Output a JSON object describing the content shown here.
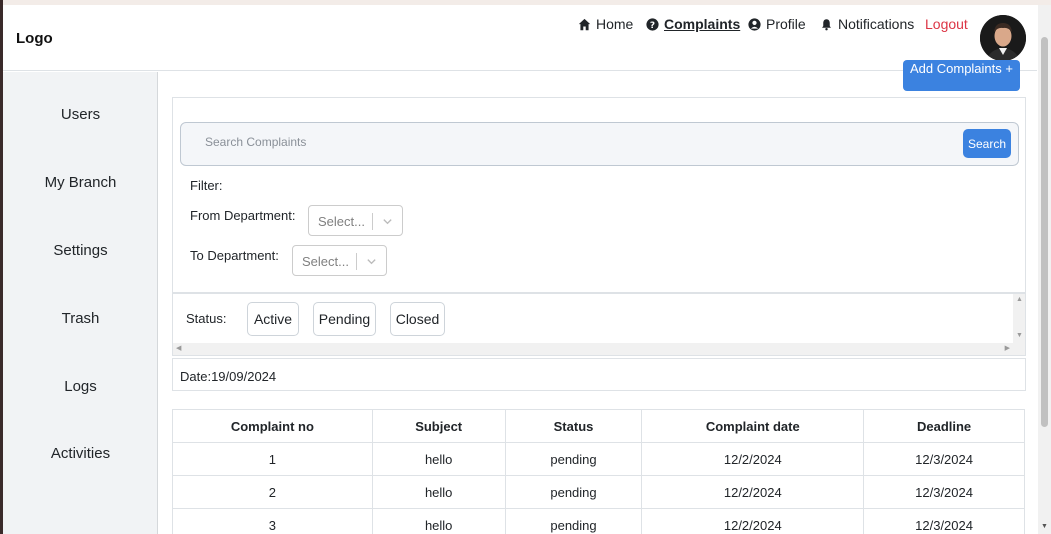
{
  "header": {
    "logo": "Logo",
    "nav": [
      {
        "label": "Home",
        "icon": "home-icon"
      },
      {
        "label": "Complaints",
        "icon": "question-circle-icon"
      },
      {
        "label": "Profile",
        "icon": "user-circle-icon"
      },
      {
        "label": "Notifications",
        "icon": "bell-icon"
      }
    ],
    "logout": "Logout"
  },
  "sidebar": {
    "items": [
      {
        "label": "Users"
      },
      {
        "label": "My Branch"
      },
      {
        "label": "Settings"
      },
      {
        "label": "Trash"
      },
      {
        "label": "Logs"
      },
      {
        "label": "Activities"
      }
    ]
  },
  "main": {
    "add_button": "Add Complaints +",
    "search": {
      "placeholder": "Search Complaints",
      "button": "Search"
    },
    "filter_label": "Filter:",
    "from_department": {
      "label": "From Department:",
      "placeholder": "Select..."
    },
    "to_department": {
      "label": "To Department:",
      "placeholder": "Select..."
    },
    "status": {
      "label": "Status:",
      "options": [
        "Active",
        "Pending",
        "Closed"
      ]
    },
    "date": "Date:19/09/2024",
    "table": {
      "headers": [
        "Complaint no",
        "Subject",
        "Status",
        "Complaint date",
        "Deadline"
      ],
      "rows": [
        [
          "1",
          "hello",
          "pending",
          "12/2/2024",
          "12/3/2024"
        ],
        [
          "2",
          "hello",
          "pending",
          "12/2/2024",
          "12/3/2024"
        ],
        [
          "3",
          "hello",
          "pending",
          "12/2/2024",
          "12/3/2024"
        ]
      ]
    }
  },
  "colors": {
    "accent": "#3b82e0",
    "logout": "#dc3545",
    "sidebar_bg": "#f1f3f5"
  }
}
